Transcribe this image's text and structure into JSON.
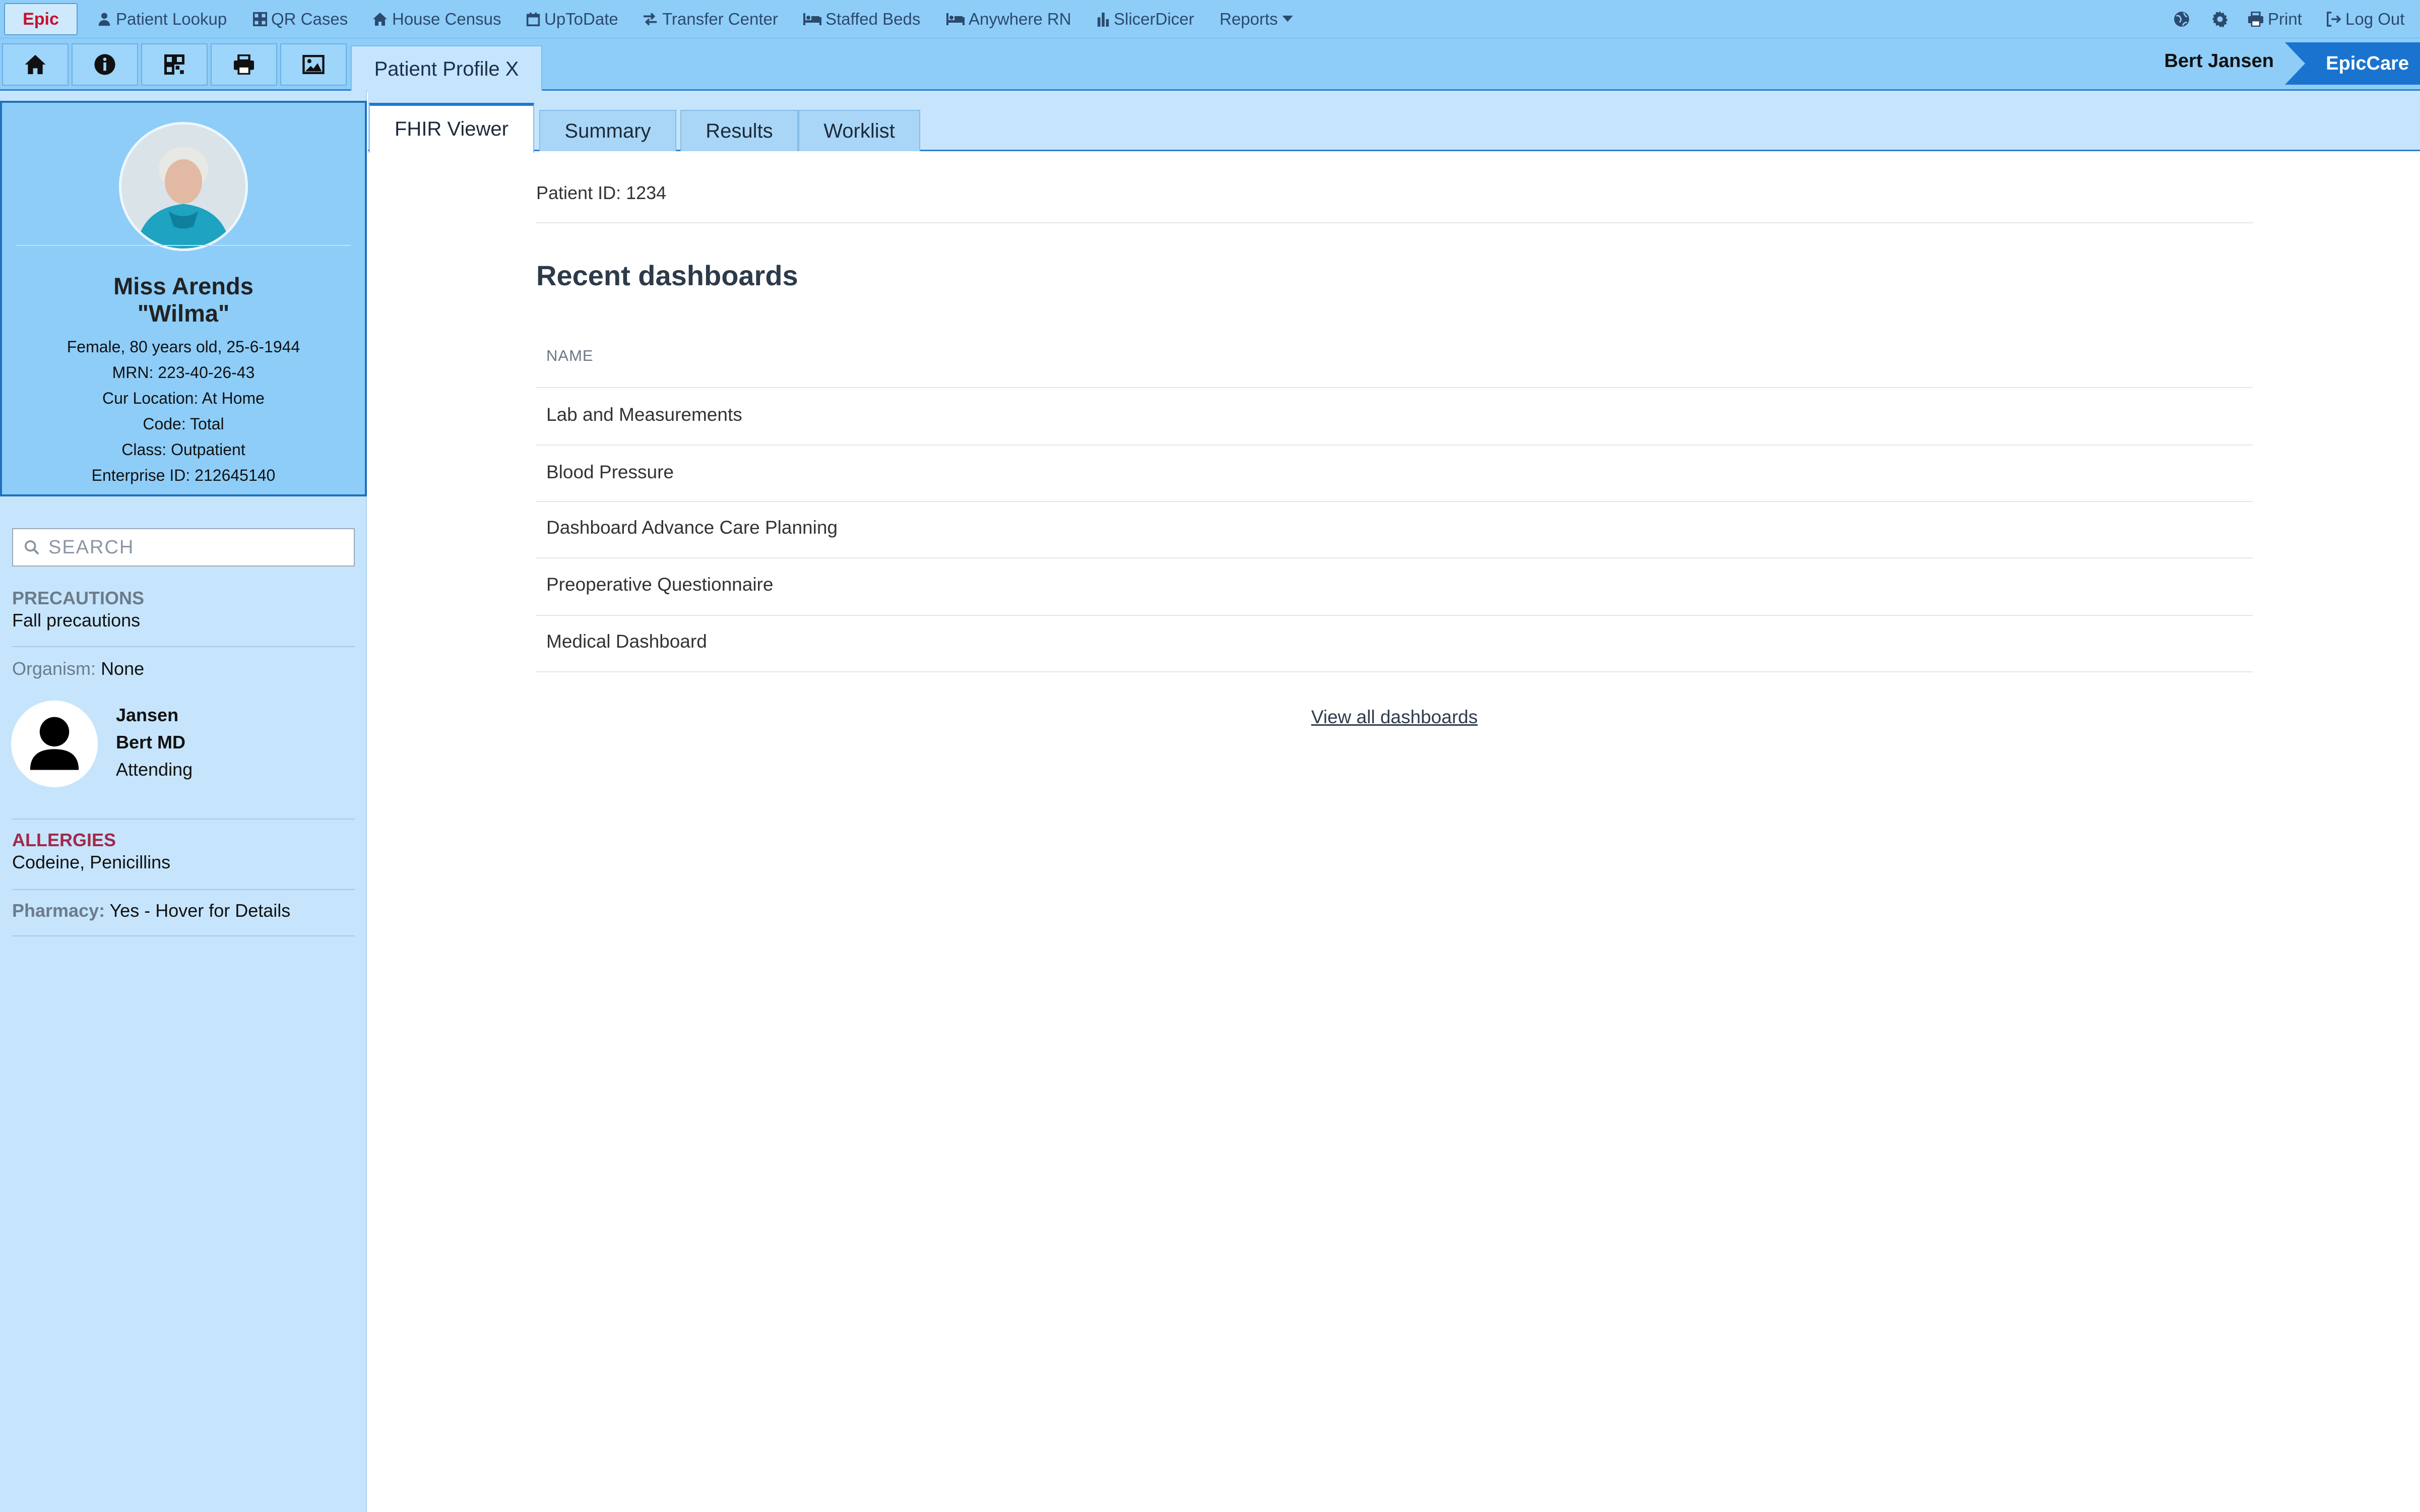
{
  "topbar": {
    "logo": "Epic",
    "menu": [
      {
        "label": "Patient Lookup",
        "icon": "user-icon"
      },
      {
        "label": "QR Cases",
        "icon": "grid-icon"
      },
      {
        "label": "House Census",
        "icon": "home-icon"
      },
      {
        "label": "UpToDate",
        "icon": "calendar-icon"
      },
      {
        "label": "Transfer Center",
        "icon": "transfer-icon"
      },
      {
        "label": "Staffed Beds",
        "icon": "bed-icon"
      },
      {
        "label": "Anywhere RN",
        "icon": "bed-icon"
      },
      {
        "label": "SlicerDicer",
        "icon": "bar-chart-icon"
      },
      {
        "label": "Reports",
        "icon": "caret-down-icon"
      }
    ],
    "print_label": "Print",
    "logout_label": "Log Out"
  },
  "toolbar": {
    "active_tab": "Patient Profile X",
    "user": "Bert Jansen",
    "brand": "EpicCare"
  },
  "patient": {
    "name": "Miss Arends",
    "nickname": "\"Wilma\"",
    "demographics": "Female, 80 years old, 25-6-1944",
    "mrn": "MRN: 223-40-26-43",
    "location": "Cur Location: At Home",
    "code": "Code: Total",
    "class": "Class: Outpatient",
    "enterprise_id": "Enterprise ID: 212645140"
  },
  "sidebar": {
    "search_placeholder": "SEARCH",
    "precautions_label": "PRECAUTIONS",
    "precautions_value": "Fall precautions",
    "organism_label": "Organism:",
    "organism_value": "None",
    "provider_last": "Jansen",
    "provider_first": "Bert MD",
    "provider_role": "Attending",
    "allergies_label": "ALLERGIES",
    "allergies_value": "Codeine, Penicillins",
    "pharmacy_label": "Pharmacy:",
    "pharmacy_value": "Yes - Hover for Details"
  },
  "tabs": [
    "FHIR Viewer",
    "Summary",
    "Results",
    "Worklist"
  ],
  "main": {
    "patient_id": "Patient ID: 1234",
    "title": "Recent dashboards",
    "column_header": "NAME",
    "rows": [
      "Lab and Measurements",
      "Blood Pressure",
      "Dashboard Advance Care Planning",
      "Preoperative Questionnaire",
      "Medical Dashboard"
    ],
    "view_all": "View all dashboards"
  },
  "colors": {
    "menu_bar": "#8ecdf8",
    "sidebar": "#c6e5fc",
    "brand_blue": "#1a74cf",
    "allergy_red": "#a3284c",
    "section_gray": "#6c7b8a"
  }
}
